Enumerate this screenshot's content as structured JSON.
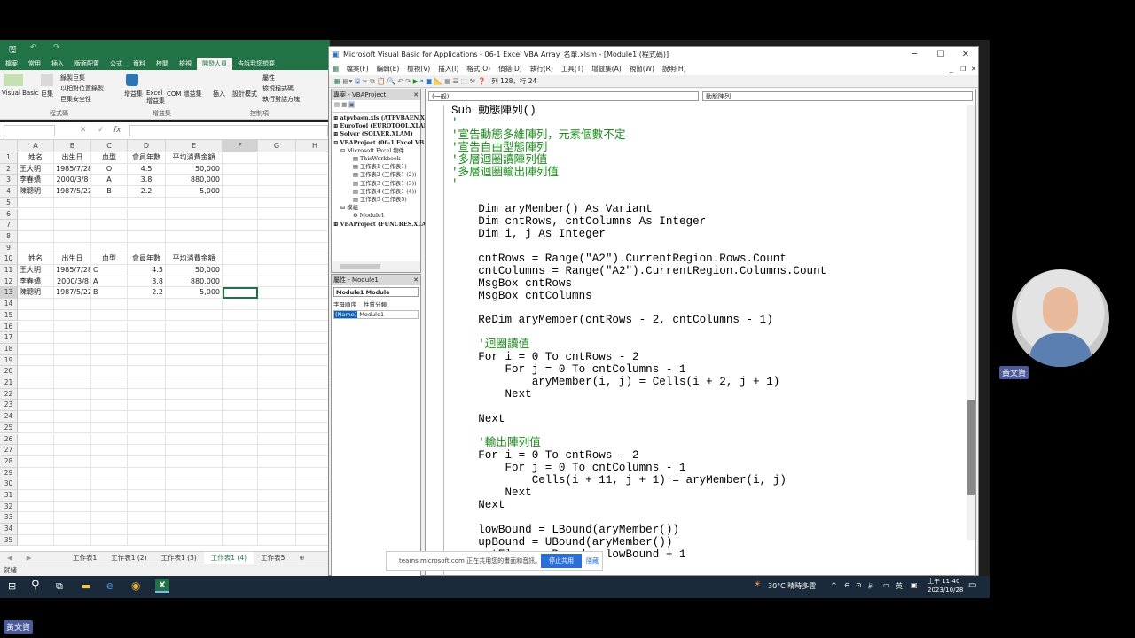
{
  "excel": {
    "tabs": [
      "檔案",
      "常用",
      "插入",
      "版面配置",
      "公式",
      "資料",
      "校閱",
      "檢視",
      "開發人員",
      "告訴我您想要"
    ],
    "ribbon": {
      "items": [
        "Visual Basic",
        "巨集",
        "錄製巨集",
        "以相對位置錄製",
        "巨集安全性",
        "增益集",
        "Excel 增益集",
        "COM 增益集",
        "插入",
        "設計模式",
        "屬性",
        "檢視程式碼",
        "執行對話方塊"
      ],
      "groups": [
        "程式碼",
        "增益集",
        "控制項"
      ]
    },
    "name_box": "",
    "formula_icons": [
      "✕",
      "✓",
      "fx"
    ],
    "columns": [
      "A",
      "B",
      "C",
      "D",
      "E",
      "F",
      "G",
      "H"
    ],
    "rows": [
      "1",
      "2",
      "3",
      "4",
      "5",
      "6",
      "7",
      "8",
      "9",
      "10",
      "11",
      "12",
      "13",
      "14",
      "15",
      "16",
      "17",
      "18",
      "19",
      "20",
      "21",
      "22",
      "23",
      "24",
      "25",
      "26",
      "27",
      "28",
      "29",
      "30",
      "31",
      "32",
      "33",
      "34",
      "35"
    ],
    "table1": {
      "headers": [
        "姓名",
        "出生日",
        "血型",
        "會員年數",
        "平均消費金額"
      ],
      "rows": [
        [
          "王大明",
          "1985/7/28",
          "O",
          "4.5",
          "50,000"
        ],
        [
          "李春嬌",
          "2000/3/8",
          "A",
          "3.8",
          "880,000"
        ],
        [
          "陳聰明",
          "1987/5/22",
          "B",
          "2.2",
          "5,000"
        ]
      ]
    },
    "table2": {
      "headers": [
        "姓名",
        "出生日",
        "血型",
        "會員年數",
        "平均消費金額"
      ],
      "rows": [
        [
          "王大明",
          "1985/7/28",
          "O",
          "4.5",
          "50,000"
        ],
        [
          "李春嬌",
          "2000/3/8",
          "A",
          "3.8",
          "880,000"
        ],
        [
          "陳聰明",
          "1987/5/22",
          "B",
          "2.2",
          "5,000"
        ]
      ]
    },
    "sheets": [
      "工作表1",
      "工作表1 (2)",
      "工作表1 (3)",
      "工作表1 (4)",
      "工作表5"
    ],
    "active_sheet": "工作表1 (4)",
    "status": "就緒"
  },
  "vbe": {
    "title": "Microsoft Visual Basic for Applications - 06-1 Excel VBA Array_名單.xlsm - [Module1 (程式碼)]",
    "menu": [
      "檔案(F)",
      "編輯(E)",
      "檢視(V)",
      "插入(I)",
      "格式(O)",
      "偵錯(D)",
      "執行(R)",
      "工具(T)",
      "增益集(A)",
      "視窗(W)",
      "說明(H)"
    ],
    "position": "列 128，行 24",
    "project_title": "專案 - VBAProject",
    "project_tree": [
      "atpvbaen.xls (ATPVBAEN.XLAM)",
      "EuroTool (EUROTOOL.XLAM)",
      "Solver (SOLVER.XLAM)",
      "VBAProject (06-1 Excel VBA Array_名單.xlsm)",
      "Microsoft Excel 物件",
      "ThisWorkbook",
      "工作表1 (工作表1)",
      "工作表2 (工作表1 (2))",
      "工作表3 (工作表1 (3))",
      "工作表4 (工作表1 (4))",
      "工作表5 (工作表5)",
      "模組",
      "Module1",
      "VBAProject (FUNCRES.XLAM)"
    ],
    "props_title": "屬性 - Module1",
    "props_object": "Module1  Module",
    "props_tabs": [
      "字母順序",
      "性質分類"
    ],
    "props_row": {
      "name": "(Name)",
      "value": "Module1"
    },
    "combo_left": "(一般)",
    "combo_right": "動態陣列",
    "code_lines": [
      "Sub 動態陣列()",
      "'",
      "'宣告動態多維陣列，元素個數不定",
      "'宣告自由型態陣列",
      "'多層迴圈讀陣列值",
      "'多層迴圈輸出陣列值",
      "'",
      "",
      "    Dim aryMember() As Variant",
      "    Dim cntRows, cntColumns As Integer",
      "    Dim i, j As Integer",
      "",
      "    cntRows = Range(\"A2\").CurrentRegion.Rows.Count",
      "    cntColumns = Range(\"A2\").CurrentRegion.Columns.Count",
      "    MsgBox cntRows",
      "    MsgBox cntColumns",
      "",
      "    ReDim aryMember(cntRows - 2, cntColumns - 1)",
      "",
      "    '迴圈讀值",
      "    For i = 0 To cntRows - 2",
      "        For j = 0 To cntColumns - 1",
      "            aryMember(i, j) = Cells(i + 2, j + 1)",
      "        Next",
      "",
      "    Next",
      "",
      "    '輸出陣列值",
      "    For i = 0 To cntRows - 2",
      "        For j = 0 To cntColumns - 1",
      "            Cells(i + 11, j + 1) = aryMember(i, j)",
      "        Next",
      "    Next",
      "",
      "    lowBound = LBound(aryMember())",
      "    upBound = UBound(aryMember())",
      "    cntElm = upBound - lowBound + 1"
    ]
  },
  "teams": {
    "message": "teams.microsoft.com 正在共用您的畫面和音訊。",
    "stop": "停止共用",
    "hide": "隱藏"
  },
  "taskbar": {
    "weather": "30°C 晴時多雲",
    "ime": "英",
    "time": "上午 11:40",
    "date": "2023/10/28"
  },
  "ime_toolbar": "英",
  "presenter": "黃文資"
}
